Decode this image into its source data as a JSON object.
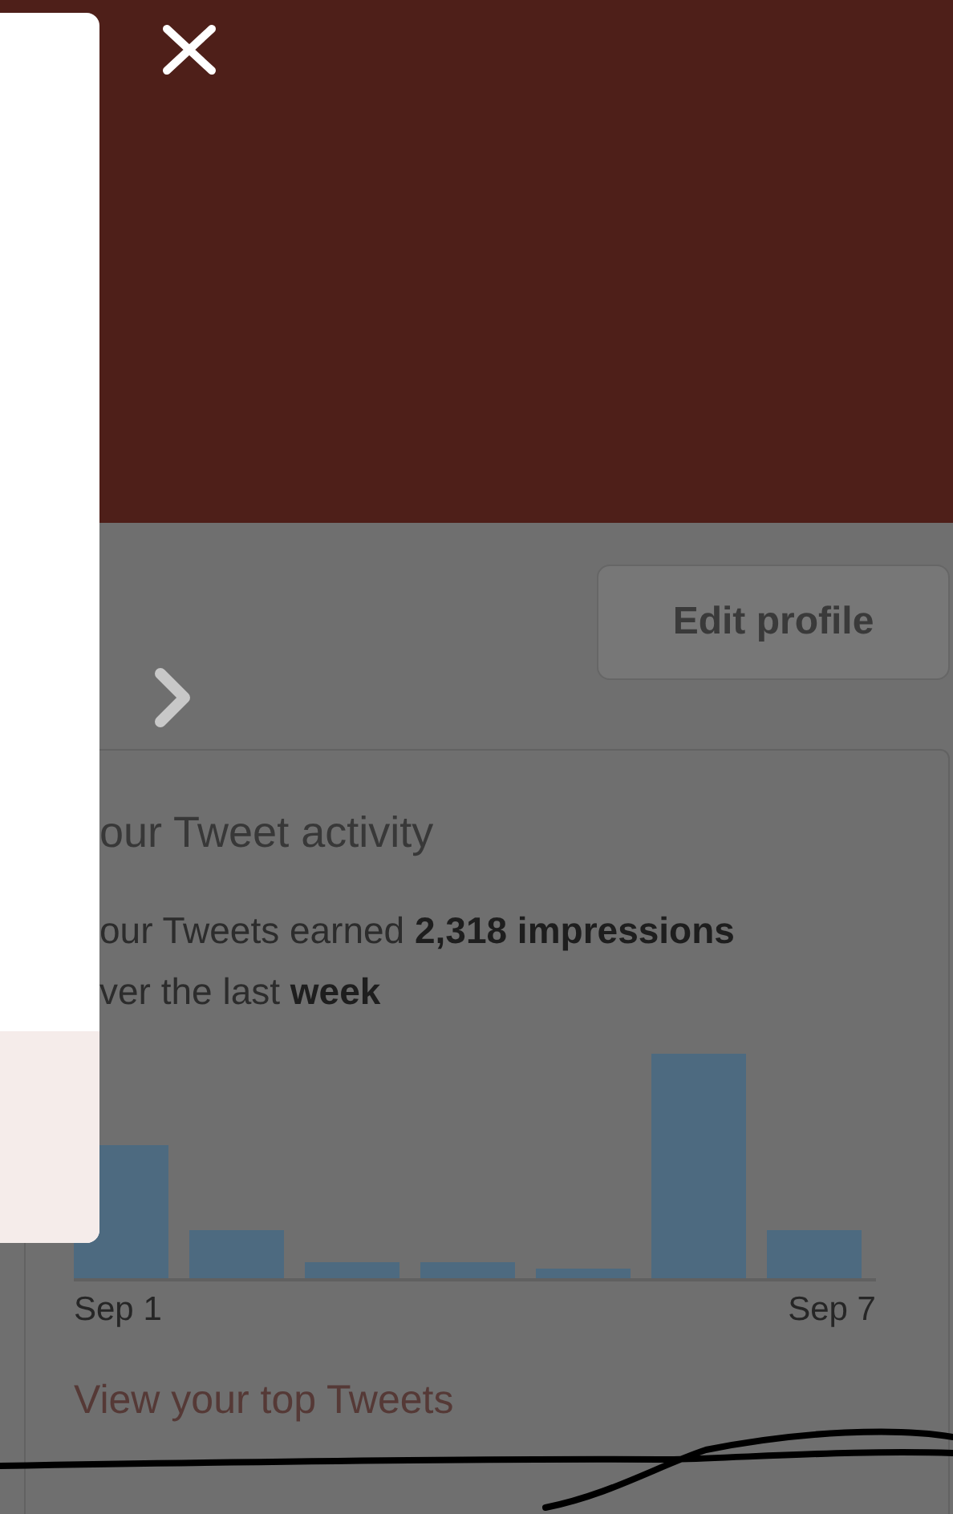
{
  "profile": {
    "edit_button": "Edit profile"
  },
  "activity_card": {
    "title": "our Tweet activity",
    "summary": "our Tweets earned **2,318 impressions**\nver the last **week**",
    "axis_start": "Sep 1",
    "axis_end": "Sep 7",
    "link": "View your top Tweets"
  }
}
